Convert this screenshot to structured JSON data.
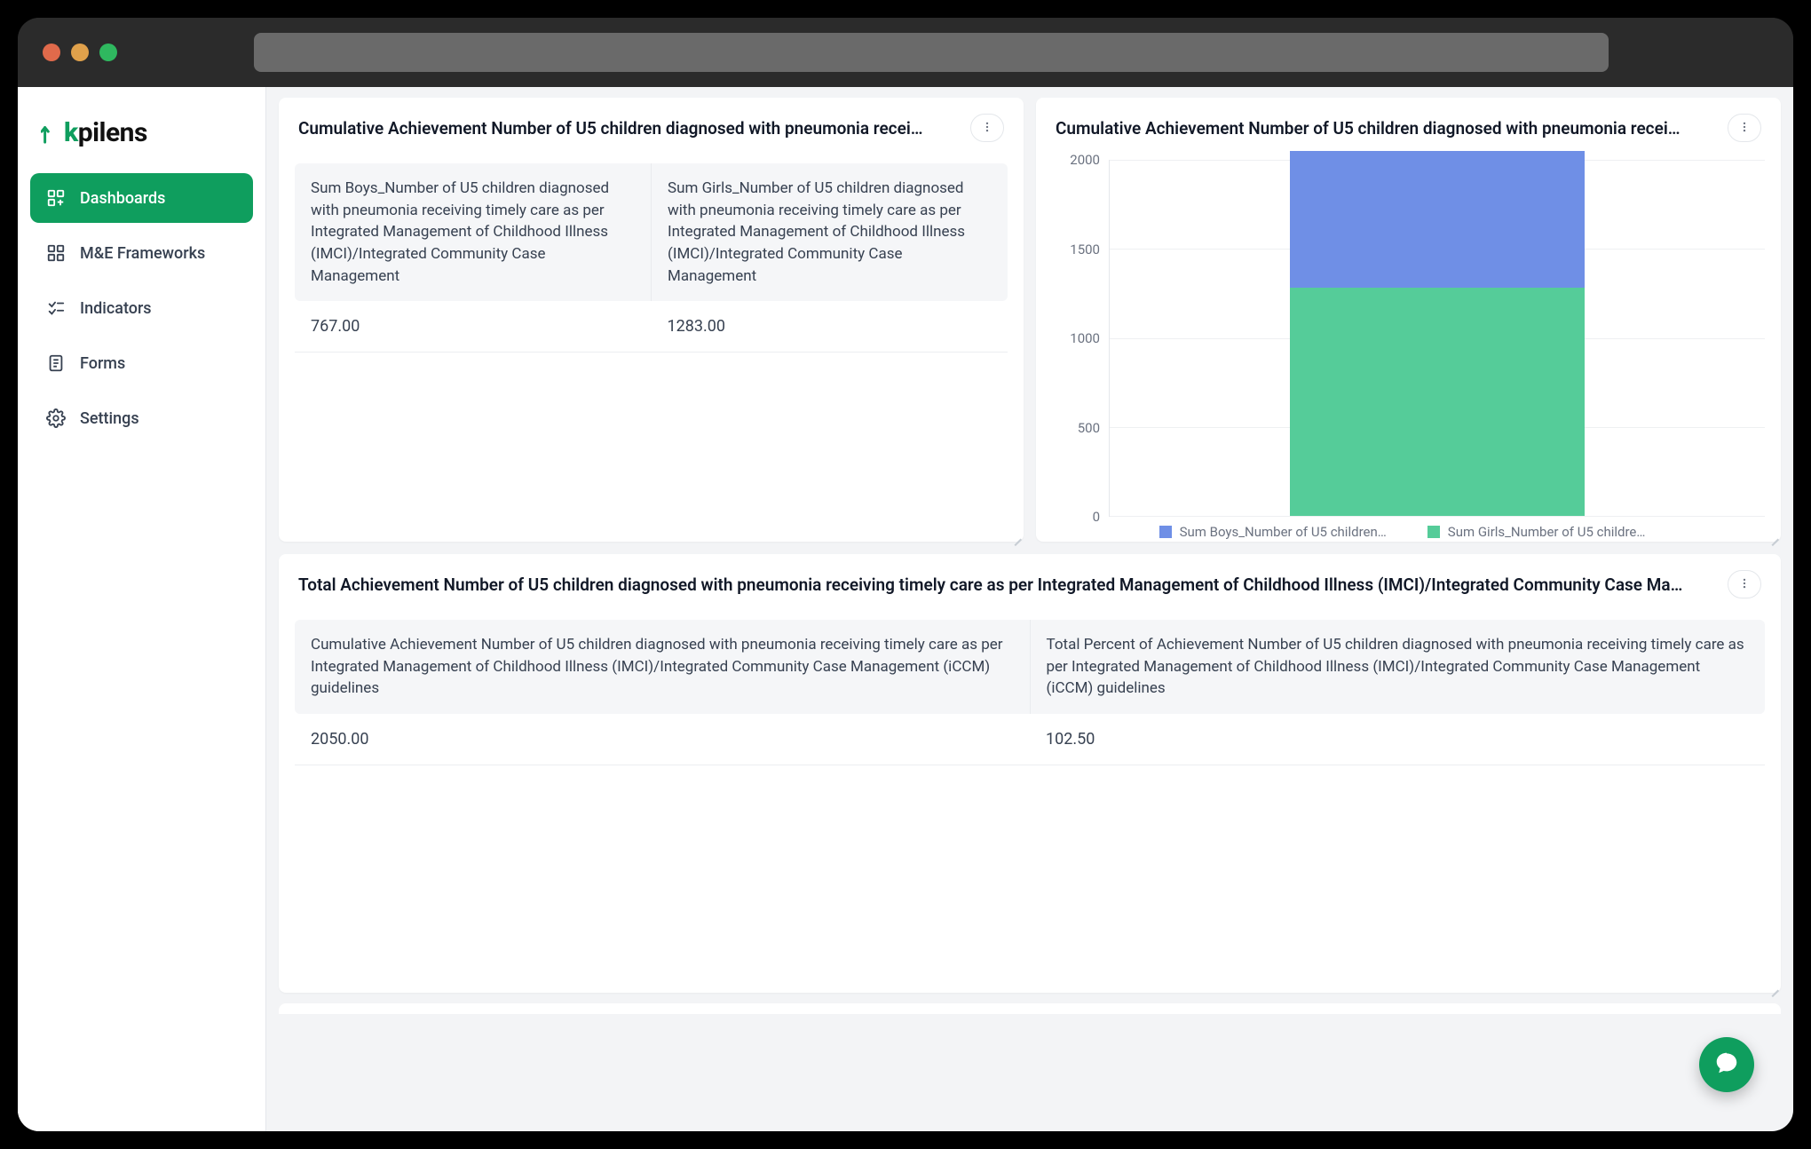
{
  "app": {
    "logo_text": "pilens",
    "logo_k": "k"
  },
  "sidebar": {
    "items": [
      {
        "label": "Dashboards",
        "icon": "dashboard-icon",
        "active": true
      },
      {
        "label": "M&E Frameworks",
        "icon": "frameworks-icon",
        "active": false
      },
      {
        "label": "Indicators",
        "icon": "indicators-icon",
        "active": false
      },
      {
        "label": "Forms",
        "icon": "forms-icon",
        "active": false
      },
      {
        "label": "Settings",
        "icon": "settings-icon",
        "active": false
      }
    ]
  },
  "cards": {
    "topLeft": {
      "title": "Cumulative Achievement Number of U5 children diagnosed with pneumonia recei…",
      "columns": [
        "Sum Boys_Number of U5 children diagnosed with pneumonia receiving timely care as per Integrated Management of Childhood Illness (IMCI)/Integrated Community Case Management",
        "Sum Girls_Number of U5 children diagnosed with pneumonia receiving timely care as per Integrated Management of Childhood Illness (IMCI)/Integrated Community Case Management"
      ],
      "row": [
        "767.00",
        "1283.00"
      ]
    },
    "topRight": {
      "title": "Cumulative Achievement Number of U5 children diagnosed with pneumonia recei…",
      "legend": [
        "Sum Boys_Number of U5 children…",
        "Sum Girls_Number of U5 childre…"
      ]
    },
    "bottom": {
      "title": "Total Achievement Number of U5 children diagnosed with pneumonia receiving timely care as per Integrated Management of Childhood Illness (IMCI)/Integrated Community Case Ma…",
      "columns": [
        "Cumulative Achievement Number of U5 children diagnosed with pneumonia receiving timely care as per Integrated Management of Childhood Illness (IMCI)/Integrated Community Case Management (iCCM) guidelines",
        "Total Percent of Achievement Number of U5 children diagnosed with pneumonia receiving timely care as per Integrated Management of Childhood Illness (IMCI)/Integrated Community Case Management (iCCM) guidelines"
      ],
      "row": [
        "2050.00",
        "102.50"
      ]
    }
  },
  "chart_data": {
    "type": "bar",
    "stacked": true,
    "categories": [
      ""
    ],
    "series": [
      {
        "name": "Sum Girls_Number of U5 children…",
        "values": [
          1283
        ],
        "color": "#55cc99"
      },
      {
        "name": "Sum Boys_Number of U5 children…",
        "values": [
          767
        ],
        "color": "#6f8fe6"
      }
    ],
    "title": "Cumulative Achievement Number of U5 children diagnosed with pneumonia recei…",
    "xlabel": "",
    "ylabel": "",
    "ylim": [
      0,
      2000
    ],
    "yticks": [
      0,
      500,
      1000,
      1500,
      2000
    ],
    "legend_position": "bottom"
  },
  "colors": {
    "accent": "#0f9e5e",
    "bar_top": "#6f8fe6",
    "bar_bot": "#55cc99"
  }
}
